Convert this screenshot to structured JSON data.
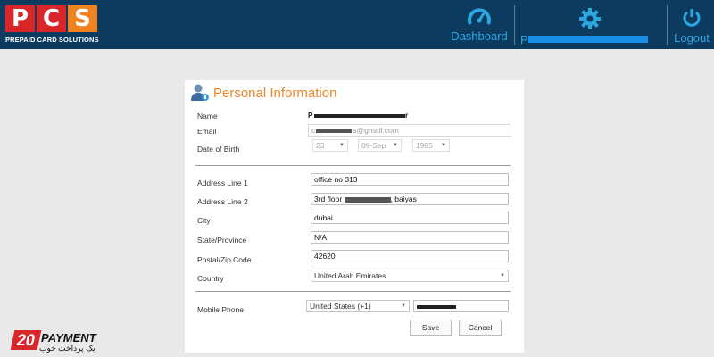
{
  "brand": {
    "letters": [
      "P",
      "C",
      "S"
    ],
    "tagline": "PREPAID CARD SOLUTIONS",
    "colors": {
      "red": "#d8262a",
      "orange": "#f0831f",
      "header_bg": "#0d3b5f",
      "nav_blue": "#2aa7e0",
      "title_orange": "#e8872b"
    }
  },
  "nav": {
    "dashboard": {
      "label": "Dashboard",
      "icon": "speedometer-icon"
    },
    "profile": {
      "label": "P",
      "icon": "gear-icon"
    },
    "logout": {
      "label": "Logout",
      "icon": "power-icon"
    }
  },
  "card": {
    "title": "Personal Information",
    "icon": "user-icon",
    "labels": {
      "name": "Name",
      "email": "Email",
      "dob": "Date of Birth",
      "address1": "Address Line 1",
      "address2": "Address Line 2",
      "city": "City",
      "state": "State/Province",
      "zip": "Postal/Zip Code",
      "country": "Country",
      "mobile": "Mobile Phone"
    },
    "values": {
      "name_start": "P",
      "name_end": "r",
      "email_start": "c",
      "email_end": "s@gmail.com",
      "dob_day": "23",
      "dob_month": "09-Sep",
      "dob_year": "1985",
      "address1": "office no  313",
      "address2_start": "3rd floor",
      "address2_end": ", baiyas",
      "city": "dubai",
      "state": "N/A",
      "zip": "42620",
      "country": "United Arab Emirates",
      "phone_country": "United States (+1)"
    },
    "buttons": {
      "save": "Save",
      "cancel": "Cancel"
    }
  },
  "badge": {
    "number": "20",
    "word": "PAYMENT",
    "subtitle": "یک پرداخت خوب"
  }
}
